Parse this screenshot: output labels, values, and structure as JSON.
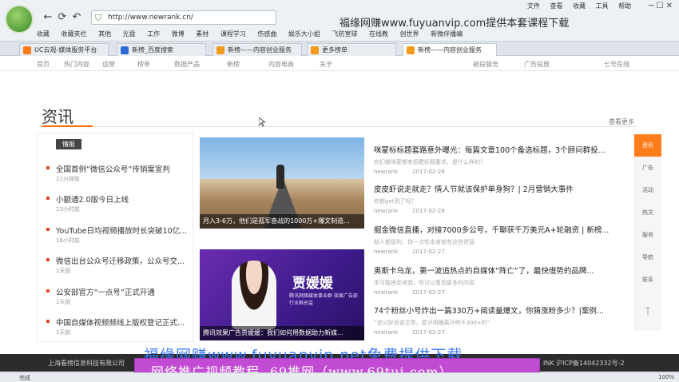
{
  "browser": {
    "url": "http://www.newrank.cn/",
    "watermark_top": "福缘网赚www.fuyuanvip.com提供本套课程下载",
    "menu": [
      "文件",
      "查看",
      "收藏",
      "工具",
      "帮助"
    ],
    "bookmarks": [
      "收藏",
      "收藏夹栏",
      "其他",
      "光盘",
      "工作",
      "微博",
      "素材",
      "课程学习",
      "伤感曲",
      "娱乐大小姐",
      "飞防室球",
      "在线教",
      "创世界",
      "新微伴播编"
    ],
    "tabs": [
      "UC云观-媒体服务平台",
      "新榜_百度搜索",
      "新榜——内容创业服务",
      "更多榜单",
      "新榜——内容创业服务"
    ],
    "status_left": "完成",
    "status_right": "100%"
  },
  "site_nav": {
    "items": [
      "首页",
      "热门内容",
      "运营",
      "榜单",
      "数据产品",
      "新榜",
      "内容电商",
      "关于",
      "被投服务",
      "广告投放",
      "七号在线"
    ]
  },
  "section": {
    "title": "资讯",
    "see_more": "查看更多"
  },
  "left_panel": {
    "tag": "情报",
    "items": [
      {
        "title": "全国首例“微信公众号”传销案宣判",
        "time": "21分钟前"
      },
      {
        "title": "小额通2.0版今日上线",
        "time": "23小时前"
      },
      {
        "title": "YouTube日均视频播放时长突破10亿...",
        "time": "18小时前"
      },
      {
        "title": "微信出台公众号迁移政策，公众号交...",
        "time": "1天前"
      },
      {
        "title": "公安部官方“一点号”正式开通",
        "time": "1天前"
      },
      {
        "title": "中国自媒体视频频线上版权登记正式...",
        "time": "1天前"
      }
    ]
  },
  "image_cards": [
    {
      "caption": "月入3-6万，他们是孤军奋战的1000万+爆文制造..."
    },
    {
      "caption": "腾讯效果广告贾媛媛：我们如何用数据助力新媒...",
      "name": "贾媛媛",
      "subtitle": "腾讯网络媒体事业群 效果广告部行业群总监"
    }
  ],
  "news": [
    {
      "headline": "咪蒙标标题套路意外曝光：每篇文章100个备选标题，3个顾问群投...",
      "summary": "你们做咪蒙都有招聘标题要求，是什么样的？",
      "source": "newrank",
      "date": "2017-02-28"
    },
    {
      "headline": "皮皮虾说走就走？情人节就该保护单身狗？| 2月营销大事件",
      "summary": "你都get到了吗？",
      "source": "newrank",
      "date": "2017-02-28"
    },
    {
      "headline": "掘金微信直播，对接7000多公号，千聊获千万美元A+轮融资 | 新榜...",
      "summary": "助人都挺利，持一次性本身就有这些资源",
      "source": "newrank",
      "date": "2017-02-27"
    },
    {
      "headline": "奥斯卡乌龙，第一波追热点的自媒体“阵亡”了，最快借势的品牌...",
      "summary": "本可能将走进我，你可以看到更多的内容",
      "source": "newrank",
      "date": "2017-02-27"
    },
    {
      "headline": "74个粉丝小号炸出一篇330万+阅读量爆文，你猜涨粉多少？|案例...",
      "summary": "“说公好而说文章，意识明确离开吧千300+的”",
      "source": "newrank",
      "date": "2017-02-27"
    }
  ],
  "right_rail": [
    "资讯",
    "广告",
    "活动",
    "热文",
    "服务",
    "导航",
    "联系"
  ],
  "footer": {
    "left": "上海看榜信息科技有限公司",
    "right": "INK 沪ICP备14042332号-2"
  },
  "watermarks": {
    "mid": "福缘网赚www.fuyuanvip.net免费提供下载",
    "banner": "网络推广视频教程--69推网（www.69tui.com）"
  },
  "colors": {
    "accent": "#ff6a00",
    "rail_active": "#ff7d1a",
    "banner": "#c24bd4",
    "bullet": "#e2462b"
  }
}
